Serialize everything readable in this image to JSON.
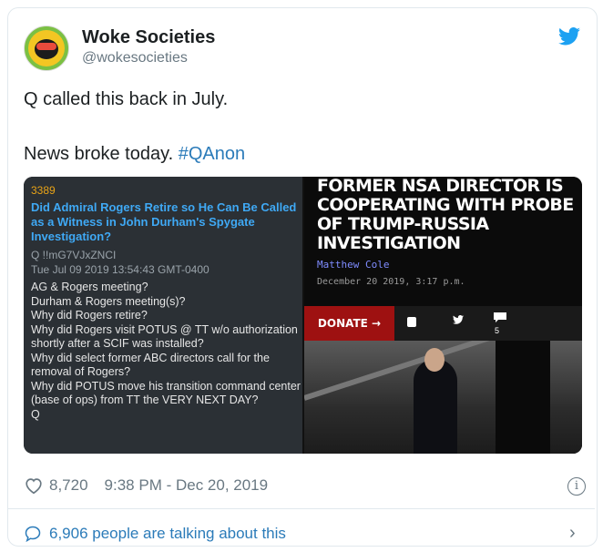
{
  "tweet": {
    "display_name": "Woke Societies",
    "handle": "@wokesocieties",
    "line1": "Q called this back in July.",
    "line2": "News broke today.",
    "hashtag": "#QAnon",
    "likes": "8,720",
    "timestamp": "9:38 PM - Dec 20, 2019",
    "talking": "6,906 people are talking about this"
  },
  "q_post": {
    "number": "3389",
    "title": "Did Admiral Rogers Retire so He Can Be Called as a Witness in John Durham's Spygate Investigation?",
    "tripcode": "Q !!mG7VJxZNCI",
    "date": "Tue Jul 09 2019 13:54:43 GMT-0400",
    "body": "AG & Rogers meeting?\nDurham & Rogers meeting(s)?\nWhy did Rogers retire?\nWhy did Rogers visit POTUS @ TT w/o authorization shortly after a SCIF was installed?\nWhy did select former ABC directors call for the removal of Rogers?\nWhy did POTUS move his transition command center (base of ops) from TT the VERY NEXT DAY?\nQ"
  },
  "article": {
    "headline": "Former NSA Director Is Cooperating With Probe of Trump-Russia Investigation",
    "author": "Matthew Cole",
    "date": "December 20 2019, 3:17 p.m.",
    "donate_label": "DONATE →",
    "comment_count": "5"
  },
  "colors": {
    "link": "#2b7bb9",
    "twitter_blue": "#1da1f2",
    "donate_red": "#9e1111",
    "q_title_blue": "#3fa9f5",
    "q_number_orange": "#e8a317"
  }
}
